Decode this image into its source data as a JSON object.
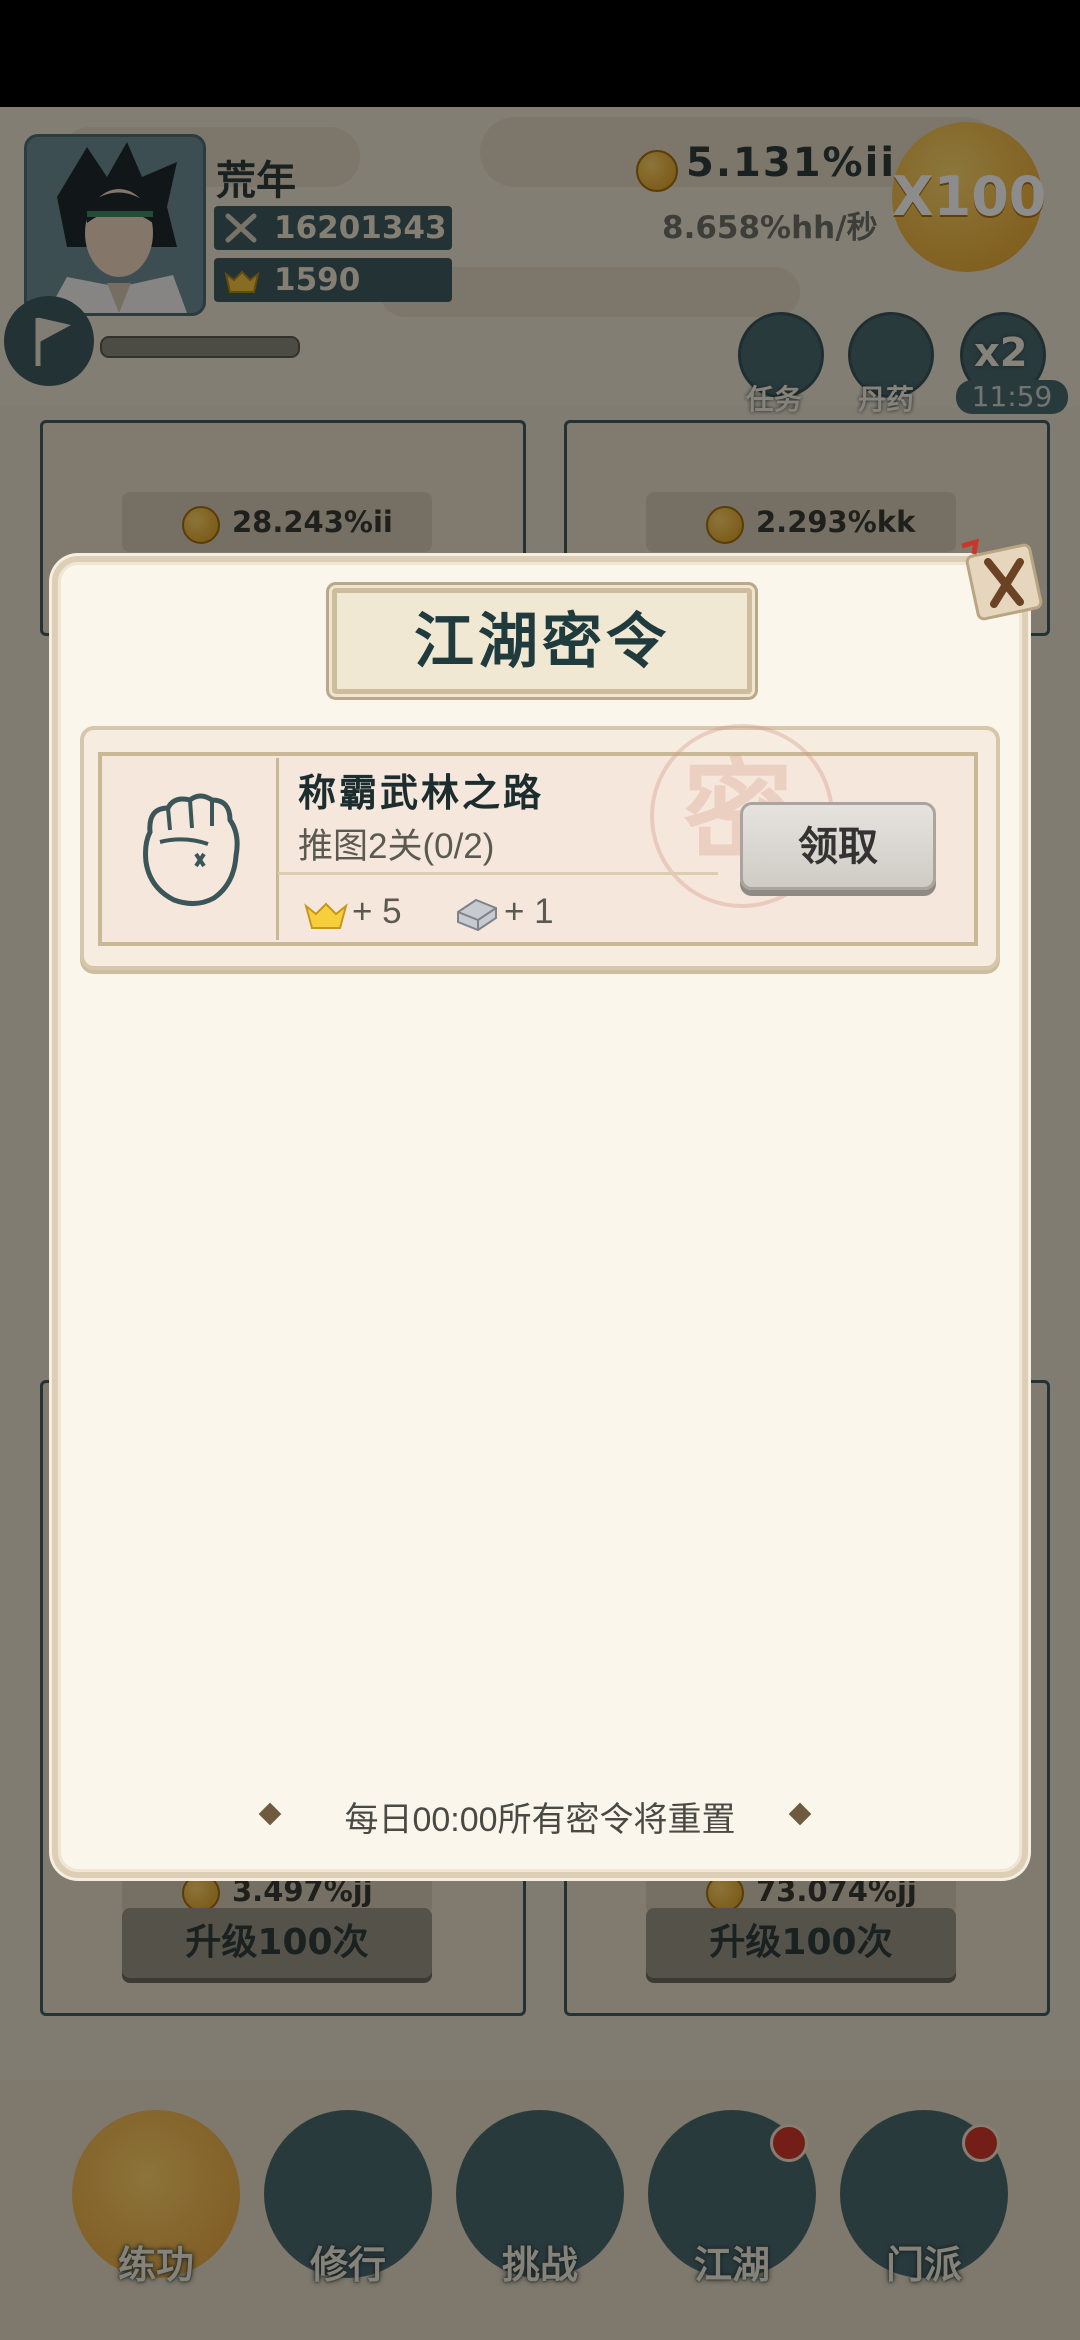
{
  "player": {
    "name": "荒年",
    "combat_power": "16201343",
    "gold_ingots": "1590"
  },
  "resources": {
    "gold": "5.131%ii",
    "gold_rate": "8.658%hh/秒",
    "multiplier_button": "X100"
  },
  "top_buttons": {
    "quest": "任务",
    "pill": "丹药",
    "speed": "x2",
    "speed_timer": "11:59"
  },
  "upgrade_cards": [
    {
      "cost": "28.243%ii"
    },
    {
      "cost": "2.293%kk"
    },
    {
      "cost": "3.497%jj",
      "button": "升级100次"
    },
    {
      "cost": "73.074%jj",
      "button": "升级100次"
    }
  ],
  "bottom_nav": [
    {
      "label": "练功",
      "active": true
    },
    {
      "label": "修行",
      "active": false
    },
    {
      "label": "挑战",
      "active": false
    },
    {
      "label": "江湖",
      "active": false,
      "badge": true
    },
    {
      "label": "门派",
      "active": false,
      "badge": true
    }
  ],
  "modal": {
    "title": "江湖密令",
    "mission": {
      "name": "称霸武林之路",
      "progress": "推图2关(0/2)",
      "rewards": [
        {
          "icon": "gold-ingot-icon",
          "text": "+ 5"
        },
        {
          "icon": "silver-ingot-icon",
          "text": "+ 1"
        }
      ],
      "claim_button": "领取",
      "seal_char": "密"
    },
    "footer_note": "每日00:00所有密令将重置"
  }
}
